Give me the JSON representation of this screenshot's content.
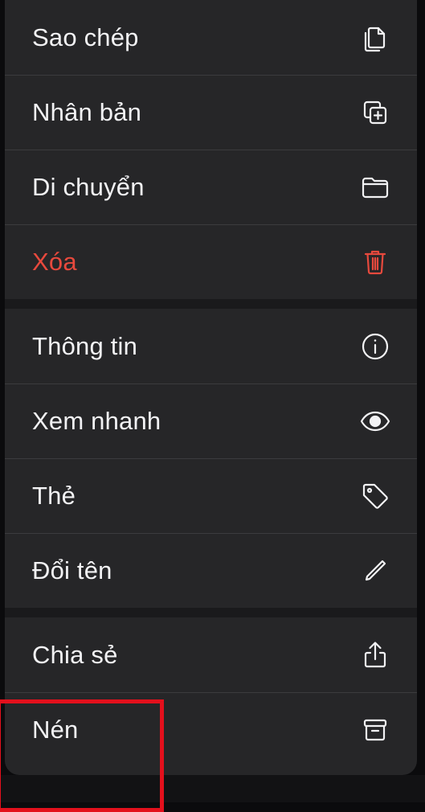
{
  "menu": {
    "groups": [
      {
        "items": [
          {
            "label": "Sao chép",
            "icon": "copy-icon"
          },
          {
            "label": "Nhân bản",
            "icon": "duplicate-icon"
          },
          {
            "label": "Di chuyển",
            "icon": "folder-icon"
          },
          {
            "label": "Xóa",
            "icon": "trash-icon",
            "destructive": true
          }
        ]
      },
      {
        "items": [
          {
            "label": "Thông tin",
            "icon": "info-icon"
          },
          {
            "label": "Xem nhanh",
            "icon": "eye-icon"
          },
          {
            "label": "Thẻ",
            "icon": "tag-icon"
          },
          {
            "label": "Đổi tên",
            "icon": "pencil-icon"
          }
        ]
      },
      {
        "items": [
          {
            "label": "Chia sẻ",
            "icon": "share-icon"
          },
          {
            "label": "Nén",
            "icon": "archive-box-icon"
          }
        ]
      }
    ]
  },
  "colors": {
    "menu_background": "#262628",
    "text": "#f2f2f4",
    "destructive": "#e7493d",
    "highlight_box": "#e3101c"
  }
}
